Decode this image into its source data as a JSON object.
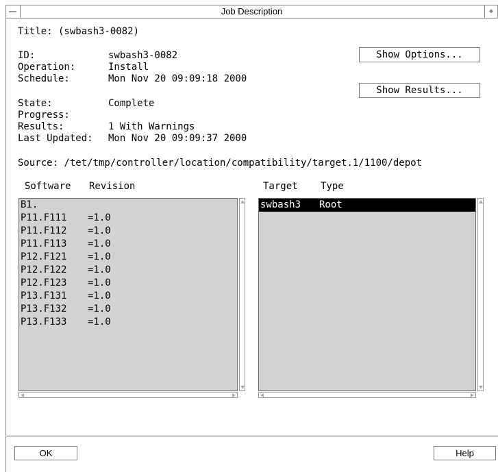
{
  "window": {
    "title": "Job Description"
  },
  "job": {
    "title_line": "Title: (swbash3-0082)",
    "fields": [
      {
        "label": "ID:",
        "value": "swbash3-0082"
      },
      {
        "label": "Operation:",
        "value": "Install"
      },
      {
        "label": "Schedule:",
        "value": "Mon Nov 20 09:09:18 2000"
      },
      {
        "label": "State:",
        "value": "Complete"
      },
      {
        "label": "Progress:",
        "value": ""
      },
      {
        "label": "Results:",
        "value": "1 With Warnings"
      },
      {
        "label": "Last Updated:",
        "value": "Mon Nov 20 09:09:37 2000"
      }
    ],
    "source_line": "Source: /tet/tmp/controller/location/compatibility/target.1/1100/depot"
  },
  "buttons": {
    "show_options": "Show Options...",
    "show_results": "Show Results...",
    "ok": "OK",
    "help": "Help"
  },
  "software_list": {
    "headers": [
      "Software",
      "Revision"
    ],
    "rows": [
      {
        "software": "B1.",
        "revision": ""
      },
      {
        "software": "P11.F111",
        "revision": "=1.0"
      },
      {
        "software": "P11.F112",
        "revision": "=1.0"
      },
      {
        "software": "P11.F113",
        "revision": "=1.0"
      },
      {
        "software": "P12.F121",
        "revision": "=1.0"
      },
      {
        "software": "P12.F122",
        "revision": "=1.0"
      },
      {
        "software": "P12.F123",
        "revision": "=1.0"
      },
      {
        "software": "P13.F131",
        "revision": "=1.0"
      },
      {
        "software": "P13.F132",
        "revision": "=1.0"
      },
      {
        "software": "P13.F133",
        "revision": "=1.0"
      }
    ]
  },
  "target_list": {
    "headers": [
      "Target",
      "Type"
    ],
    "rows": [
      {
        "target": "swbash3",
        "type": "Root",
        "selected": true
      }
    ]
  }
}
